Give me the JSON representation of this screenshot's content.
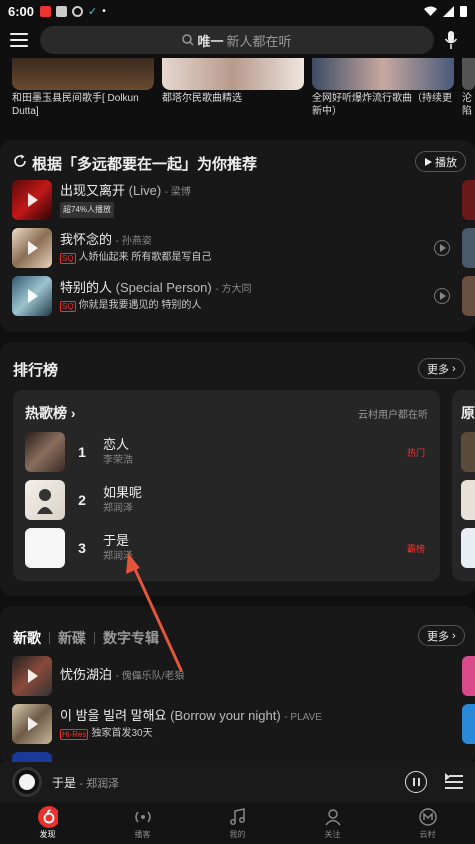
{
  "status_bar": {
    "time": "6:00"
  },
  "search": {
    "placeholder_bold": "唯一",
    "placeholder_rest": "新人都在听"
  },
  "top_cards": [
    {
      "caption": "和田墨玉县民间歌手[ Dolkun Dutta]"
    },
    {
      "caption": "都塔尔民歌曲精选"
    },
    {
      "caption": "全网好听爆炸流行歌曲（持续更新中）"
    },
    {
      "caption": "沦陷"
    }
  ],
  "recommend": {
    "title": "根据「多远都要在一起」为你推荐",
    "play_label": "播放",
    "songs": [
      {
        "name": "出现又离开",
        "version": "(Live)",
        "artist": "梁博",
        "sub": "超74%人播放",
        "tag": "hot"
      },
      {
        "name": "我怀念的",
        "version": "",
        "artist": "孙燕姿",
        "sub": "人娇仙起来 所有歌都是写自己",
        "tag": "SQ"
      },
      {
        "name": "特别的人",
        "version": "(Special Person)",
        "artist": "方大同",
        "sub": "你就是我要遇见的 特别的人",
        "tag": "SQ"
      }
    ]
  },
  "charts": {
    "title": "排行榜",
    "more_label": "更多",
    "card_title": "热歌榜",
    "card_subtitle": "云村用户都在听",
    "next_card_title": "原",
    "rows": [
      {
        "rank": "1",
        "name": "恋人",
        "artist": "李荣浩",
        "badge": "热门"
      },
      {
        "rank": "2",
        "name": "如果呢",
        "artist": "郑润泽",
        "badge": ""
      },
      {
        "rank": "3",
        "name": "于是",
        "artist": "郑润泽",
        "badge": "霸榜"
      }
    ]
  },
  "new_section": {
    "tabs": [
      "新歌",
      "新碟",
      "数字专辑"
    ],
    "more_label": "更多",
    "songs": [
      {
        "name": "忧伤湖泊",
        "version": "",
        "artist": "傀儡乐队/老狼",
        "sub": "",
        "tag": ""
      },
      {
        "name": "이 밤을 빌려 말해요",
        "version": "(Borrow your night)",
        "artist": "PLAVE",
        "sub": "独家首发30天",
        "tag": "Hi-Res"
      }
    ]
  },
  "mini_player": {
    "title": "于是",
    "artist": "郑润泽"
  },
  "bottom_nav": [
    {
      "label": "发现",
      "icon": "discover-icon"
    },
    {
      "label": "播客",
      "icon": "podcast-icon"
    },
    {
      "label": "我的",
      "icon": "music-note-icon"
    },
    {
      "label": "关注",
      "icon": "user-icon"
    },
    {
      "label": "云村",
      "icon": "cloud-village-icon"
    }
  ],
  "colors": {
    "brand_red": "#e8322d",
    "background": "#0f0f0f",
    "card": "#181818",
    "annotation_arrow": "#e2563b"
  }
}
